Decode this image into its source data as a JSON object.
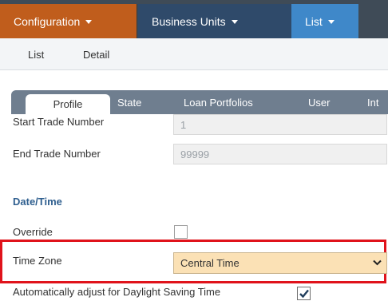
{
  "topnav": {
    "configuration": "Configuration",
    "business_units": "Business Units",
    "list": "List"
  },
  "subnav": {
    "list": "List",
    "detail": "Detail"
  },
  "tabs": {
    "profile": "Profile",
    "state": "State",
    "loan_portfolios": "Loan Portfolios",
    "user": "User",
    "partial": "Int"
  },
  "form": {
    "start_trade_label": "Start Trade Number",
    "start_trade_value": "1",
    "end_trade_label": "End Trade Number",
    "end_trade_value": "99999",
    "section_datetime": "Date/Time",
    "override_label": "Override",
    "override_checked": false,
    "time_zone_label": "Time Zone",
    "time_zone_value": "Central Time",
    "dst_label": "Automatically adjust for Daylight Saving Time",
    "dst_checked": true
  },
  "colors": {
    "highlight": "#e0131b",
    "select_bg": "#fbe1b5",
    "config_tab": "#c05d1c",
    "business_tab": "#2f4a6a",
    "list_tab": "#3f88c9"
  }
}
